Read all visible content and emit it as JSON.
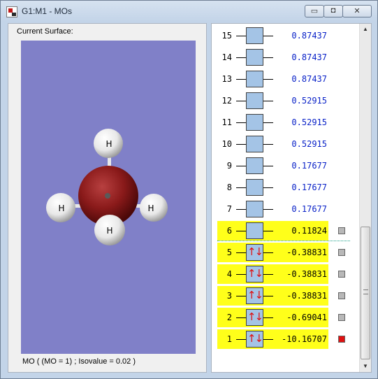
{
  "window": {
    "title": "G1:M1 - MOs",
    "minimize_glyph": "▭",
    "maximize_glyph": "◘",
    "close_glyph": "✕"
  },
  "left_panel": {
    "surface_label": "Current Surface:",
    "status": "MO ( (MO = 1) ; Isovalue = 0.02 )",
    "atoms": [
      "H",
      "H",
      "H",
      "H"
    ],
    "colors": {
      "background": "#8080c8",
      "carbon": "#8a1a1a",
      "hydrogen": "#f0f0f0"
    }
  },
  "mo_list": {
    "orbitals": [
      {
        "num": "15",
        "energy": "0.87437",
        "occupied": false,
        "electrons": ""
      },
      {
        "num": "14",
        "energy": "0.87437",
        "occupied": false,
        "electrons": ""
      },
      {
        "num": "13",
        "energy": "0.87437",
        "occupied": false,
        "electrons": ""
      },
      {
        "num": "12",
        "energy": "0.52915",
        "occupied": false,
        "electrons": ""
      },
      {
        "num": "11",
        "energy": "0.52915",
        "occupied": false,
        "electrons": ""
      },
      {
        "num": "10",
        "energy": "0.52915",
        "occupied": false,
        "electrons": ""
      },
      {
        "num": "9",
        "energy": "0.17677",
        "occupied": false,
        "electrons": ""
      },
      {
        "num": "8",
        "energy": "0.17677",
        "occupied": false,
        "electrons": ""
      },
      {
        "num": "7",
        "energy": "0.17677",
        "occupied": false,
        "electrons": ""
      },
      {
        "num": "6",
        "energy": "0.11824",
        "occupied": false,
        "highlighted": true,
        "checked": false,
        "electrons": ""
      },
      {
        "num": "5",
        "energy": "-0.38831",
        "occupied": true,
        "highlighted": true,
        "checked": false,
        "electrons": "↑↓"
      },
      {
        "num": "4",
        "energy": "-0.38831",
        "occupied": true,
        "highlighted": true,
        "checked": false,
        "electrons": "↑↓"
      },
      {
        "num": "3",
        "energy": "-0.38831",
        "occupied": true,
        "highlighted": true,
        "checked": false,
        "electrons": "↑↓"
      },
      {
        "num": "2",
        "energy": "-0.69041",
        "occupied": true,
        "highlighted": true,
        "checked": false,
        "electrons": "↑↓"
      },
      {
        "num": "1",
        "energy": "-10.16707",
        "occupied": true,
        "highlighted": true,
        "checked": true,
        "electrons": "↑↓"
      }
    ],
    "colors": {
      "highlight": "#ffff1a",
      "box": "#a4c4e6",
      "virtual_energy": "#0a22c8",
      "selected_marker": "#e01010"
    }
  },
  "scrollbar": {
    "up_glyph": "▲",
    "down_glyph": "▼"
  }
}
